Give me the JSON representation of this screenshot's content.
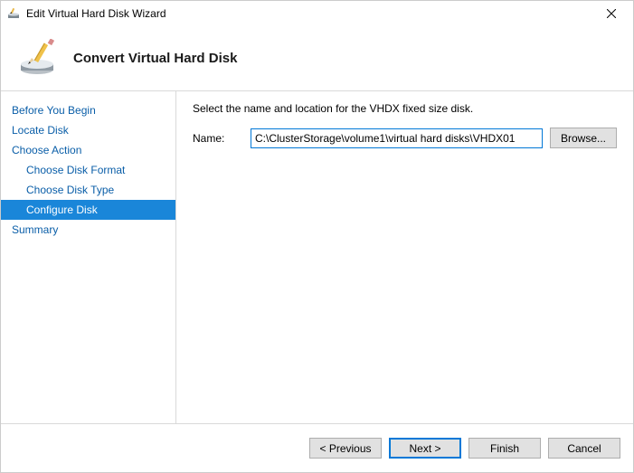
{
  "window": {
    "title": "Edit Virtual Hard Disk Wizard"
  },
  "header": {
    "title": "Convert Virtual Hard Disk"
  },
  "sidebar": {
    "items": [
      {
        "label": "Before You Begin",
        "indent": 0
      },
      {
        "label": "Locate Disk",
        "indent": 0
      },
      {
        "label": "Choose Action",
        "indent": 0
      },
      {
        "label": "Choose Disk Format",
        "indent": 1
      },
      {
        "label": "Choose Disk Type",
        "indent": 1
      },
      {
        "label": "Configure Disk",
        "indent": 1,
        "selected": true
      },
      {
        "label": "Summary",
        "indent": 0
      }
    ]
  },
  "content": {
    "instruction": "Select the name and location for the VHDX fixed size disk.",
    "name_label": "Name:",
    "name_value": "C:\\ClusterStorage\\volume1\\virtual hard disks\\VHDX01",
    "browse_label": "Browse..."
  },
  "footer": {
    "previous": "< Previous",
    "next": "Next >",
    "finish": "Finish",
    "cancel": "Cancel"
  }
}
